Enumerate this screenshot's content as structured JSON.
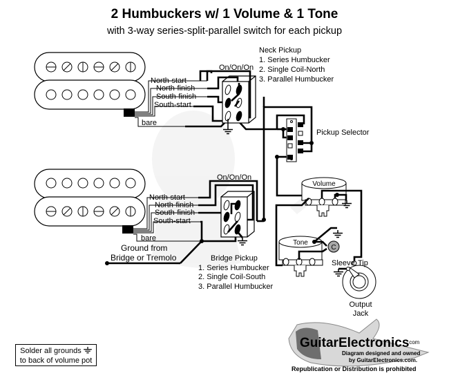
{
  "title": "2 Humbuckers w/ 1 Volume & 1 Tone",
  "subtitle": "with 3-way series-split-parallel switch for each pickup",
  "neck_pickup": {
    "heading": "Neck Pickup",
    "options": [
      "1. Series Humbucker",
      "2. Single Coil-North",
      "3. Parallel Humbucker"
    ],
    "switch_label": "On/On/On",
    "wires": [
      "North-start",
      "North-finish",
      "South-finish",
      "South-start",
      "bare"
    ]
  },
  "bridge_pickup": {
    "heading": "Bridge Pickup",
    "options": [
      "1. Series Humbucker",
      "2. Single Coil-South",
      "3. Parallel Humbucker"
    ],
    "switch_label": "On/On/On",
    "wires": [
      "North-start",
      "North-finish",
      "South-finish",
      "South-start",
      "bare"
    ]
  },
  "pickup_selector_label": "Pickup Selector",
  "volume_pot_label": "Volume",
  "tone_pot_label": "Tone",
  "capacitor_label": "C",
  "ground_from_label": [
    "Ground from",
    "Bridge or Tremolo"
  ],
  "jack": {
    "sleeve_label": "Sleeve",
    "tip_label": "Tip",
    "name": [
      "Output",
      "Jack"
    ]
  },
  "note": [
    "Solder all grounds",
    "to back of volume pot"
  ],
  "logo": {
    "brand": "GuitarElectronics",
    "tld": ".com",
    "credit_line1": "Diagram designed and owned",
    "credit_line2": "by GuitarElectronics.com.",
    "notice": "Republication or Distribution is prohibited"
  },
  "colors": {
    "capacitor": "#a8a8a8",
    "watermark": "#e6e6e6",
    "logo_gray": "#6e6e6e"
  }
}
